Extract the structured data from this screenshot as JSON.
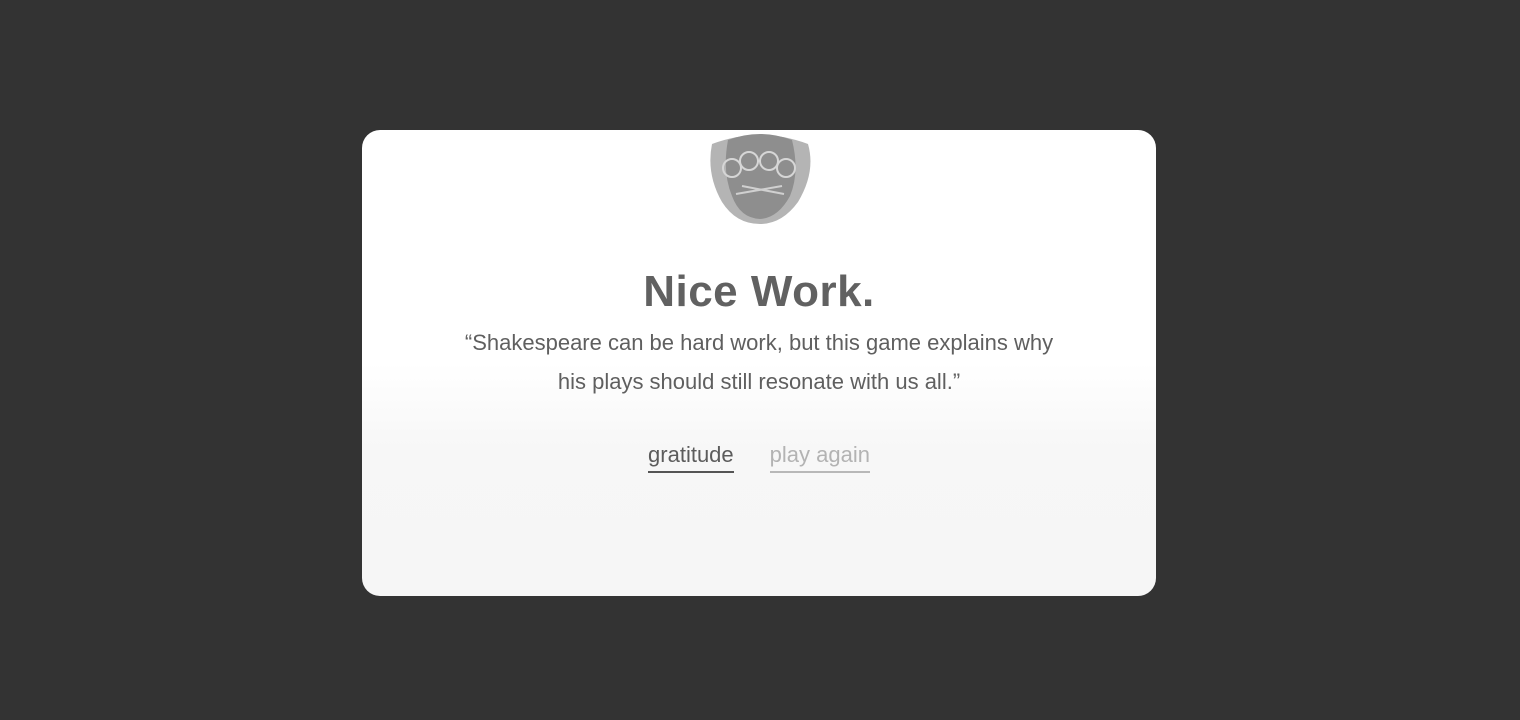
{
  "modal": {
    "avatar_icon": "bald-man-with-glasses-avatar-icon",
    "title": "Nice Work.",
    "quote": "“Shakespeare can be hard work, but this game explains why his plays should still resonate with us all.”",
    "actions": {
      "gratitude_label": "gratitude",
      "play_again_label": "play again"
    }
  },
  "colors": {
    "backdrop": "#333333",
    "card": "#ffffff",
    "text_dark": "#616161",
    "link_muted": "#b3b3b3"
  }
}
